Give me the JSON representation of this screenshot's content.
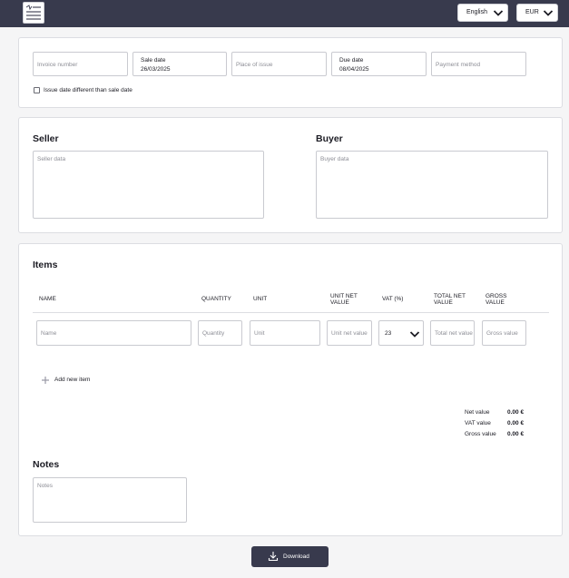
{
  "header": {
    "logo_icon": "invoice-icon",
    "language": "English",
    "currency": "EUR"
  },
  "invoice": {
    "invoice_number_placeholder": "Invoice number",
    "sale_date_label": "Sale date",
    "sale_date_value": "26/03/2025",
    "place_of_issue_placeholder": "Place of issue",
    "due_date_label": "Due date",
    "due_date_value": "08/04/2025",
    "payment_method_placeholder": "Payment method",
    "issue_date_checkbox_label": "Issue date different than sale date"
  },
  "parties": {
    "seller_title": "Seller",
    "seller_placeholder": "Seller data",
    "buyer_title": "Buyer",
    "buyer_placeholder": "Buyer data"
  },
  "items": {
    "title": "Items",
    "columns": {
      "name": "NAME",
      "quantity": "QUANTITY",
      "unit": "UNIT",
      "unit_net_value": [
        "UNIT NET",
        "VALUE"
      ],
      "vat": "VAT (%)",
      "total_net_value": [
        "TOTAL NET",
        "VALUE"
      ],
      "gross_value": [
        "GROSS",
        "VALUE"
      ]
    },
    "row": {
      "name_placeholder": "Name",
      "quantity_placeholder": "Quantity",
      "unit_placeholder": "Unit",
      "unit_net_placeholder": "Unit net value",
      "vat_value": "23",
      "total_net_placeholder": "Total net value",
      "gross_placeholder": "Gross value"
    },
    "add_new_label": "Add new item"
  },
  "summary": {
    "net_label": "Net value",
    "net_value": "0.00 €",
    "vat_label": "VAT value",
    "vat_value": "0.00 €",
    "gross_label": "Gross value",
    "gross_value": "0.00 €"
  },
  "notes": {
    "title": "Notes",
    "placeholder": "Notes"
  },
  "actions": {
    "download_label": "Download"
  },
  "colors": {
    "header_bg": "#383a4d",
    "button_bg": "#383a4d",
    "page_bg": "#f5f5f6",
    "card_border": "#dcdde2"
  }
}
